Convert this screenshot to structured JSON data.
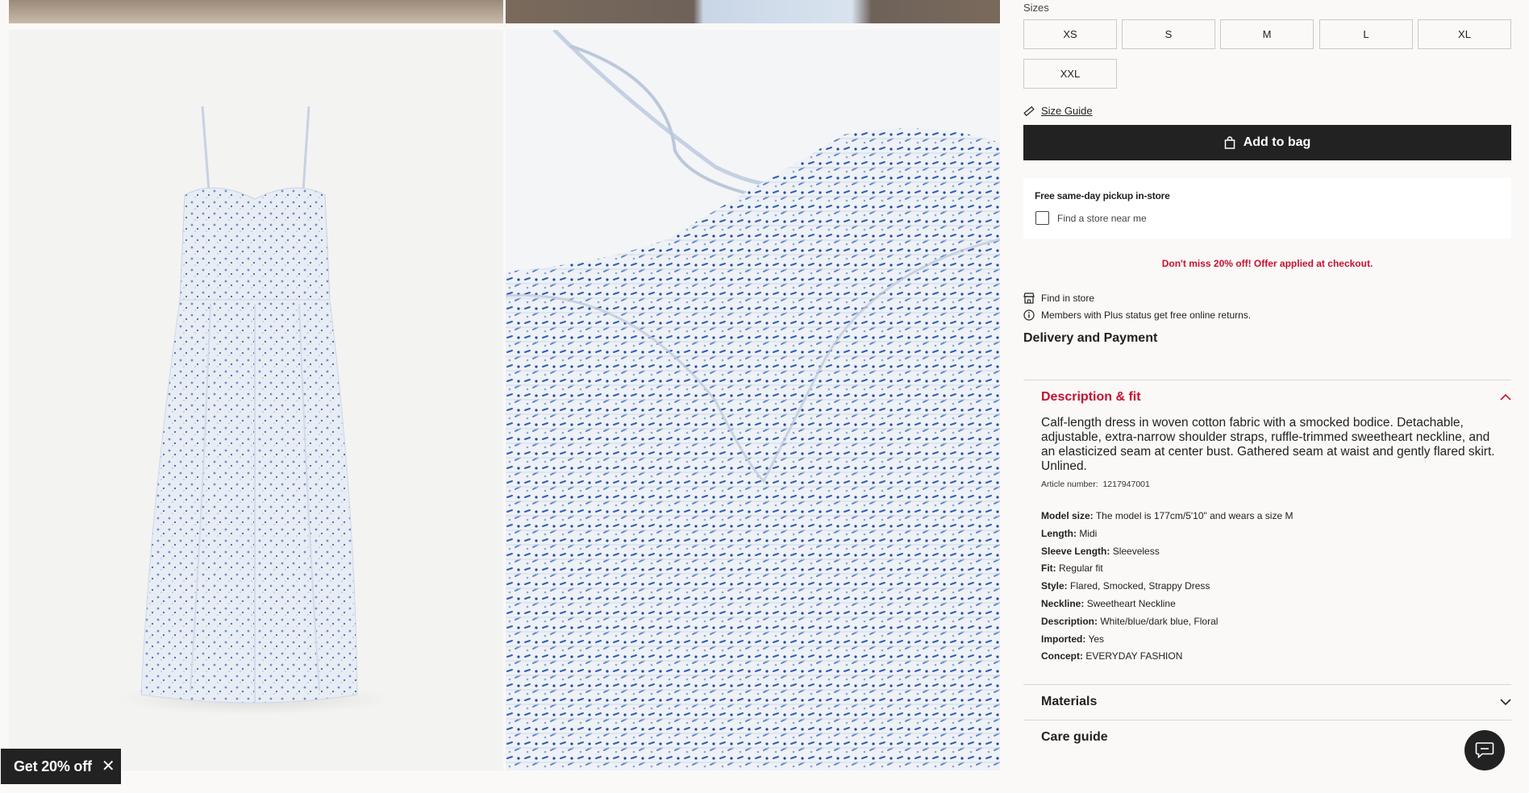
{
  "sizes": {
    "label": "Sizes",
    "options": [
      "XS",
      "S",
      "M",
      "L",
      "XL",
      "XXL"
    ]
  },
  "size_guide": {
    "label": "Size Guide",
    "icon": "ruler-icon"
  },
  "add_to_bag": {
    "label": "Add to bag",
    "icon": "bag-icon"
  },
  "pickup": {
    "title": "Free same-day pickup in-store",
    "checkbox_label": "Find a store near me"
  },
  "offer": "Don't miss 20% off! Offer applied at checkout.",
  "find_in_store": "Find in store",
  "members_info": "Members with Plus status get free online returns.",
  "delivery": "Delivery and Payment",
  "description": {
    "title": "Description & fit",
    "text": "Calf-length dress in woven cotton fabric with a smocked bodice. Detachable, adjustable, extra-narrow shoulder straps, ruffle-trimmed sweetheart neckline, and an elasticized seam at center bust. Gathered seam at waist and gently flared skirt. Unlined.",
    "article_label": "Article number:",
    "article_number": "1217947001",
    "specs": [
      {
        "key": "Model size:",
        "value": "The model is 177cm/5'10\" and wears a size M"
      },
      {
        "key": "Length:",
        "value": "Midi"
      },
      {
        "key": "Sleeve Length:",
        "value": "Sleeveless"
      },
      {
        "key": "Fit:",
        "value": "Regular fit"
      },
      {
        "key": "Style:",
        "value": "Flared, Smocked, Strappy Dress"
      },
      {
        "key": "Neckline:",
        "value": "Sweetheart Neckline"
      },
      {
        "key": "Description:",
        "value": "White/blue/dark blue, Floral"
      },
      {
        "key": "Imported:",
        "value": "Yes"
      },
      {
        "key": "Concept:",
        "value": "EVERYDAY FASHION"
      }
    ]
  },
  "materials": "Materials",
  "care_guide": "Care guide",
  "promo": {
    "label": "Get 20% off"
  },
  "colors": {
    "accent_red": "#c8102e",
    "dark": "#222222"
  }
}
